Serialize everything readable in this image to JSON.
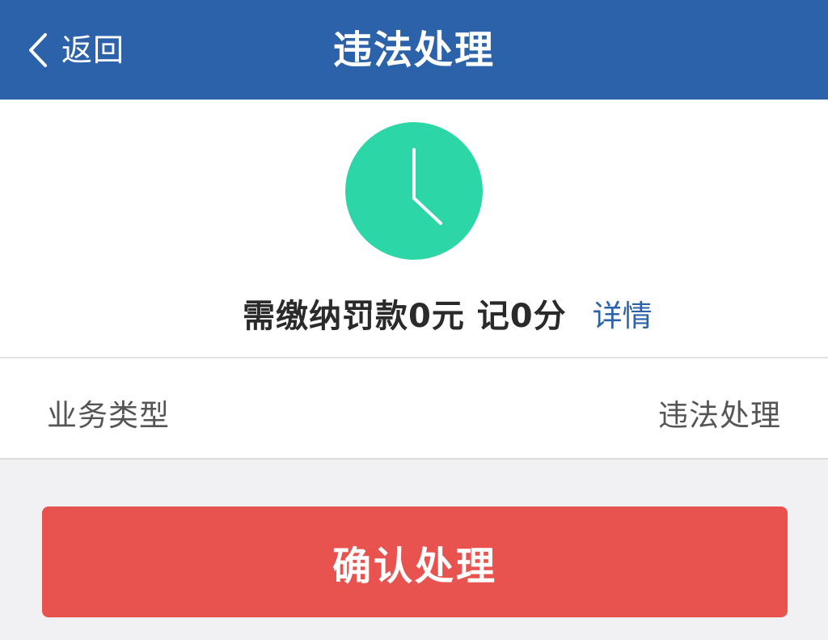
{
  "header": {
    "back_label": "返回",
    "title": "违法处理",
    "background": "#2c62a9"
  },
  "summary": {
    "status_icon": "clock-icon",
    "icon_color": "#2dd6a7",
    "fine_text": "需缴纳罚款0元 记0分",
    "detail_link": "详情"
  },
  "business": {
    "label": "业务类型",
    "value": "违法处理"
  },
  "confirm": {
    "label": "确认处理",
    "color": "#e8534f"
  }
}
